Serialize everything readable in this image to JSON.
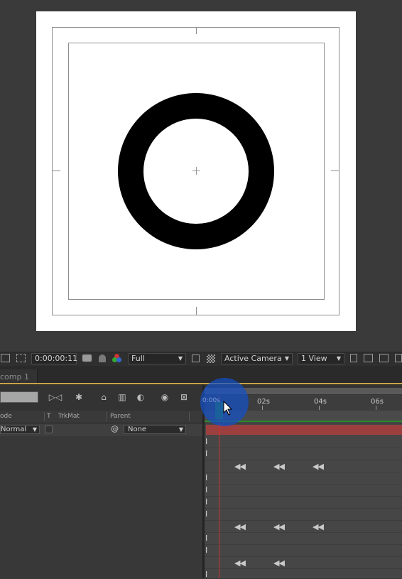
{
  "viewer_toolbar": {
    "timecode": "0:00:00:11",
    "resolution": "Full",
    "camera": "Active Camera",
    "views": "1 View"
  },
  "tab": {
    "label": "comp 1"
  },
  "columns": {
    "mode": "ode",
    "t": "T",
    "trkmat": "TrkMat",
    "parent": "Parent"
  },
  "layer": {
    "mode_value": "Normal",
    "parent_value": "None"
  },
  "ruler": {
    "ticks": [
      "02s",
      "04s",
      "06s"
    ],
    "current": "0:00s"
  },
  "colors": {
    "accent_tab": "#c9a44a",
    "layer_bar": "#9e3f3f",
    "cti": "#d23030",
    "click_halo": "#1450c8"
  }
}
